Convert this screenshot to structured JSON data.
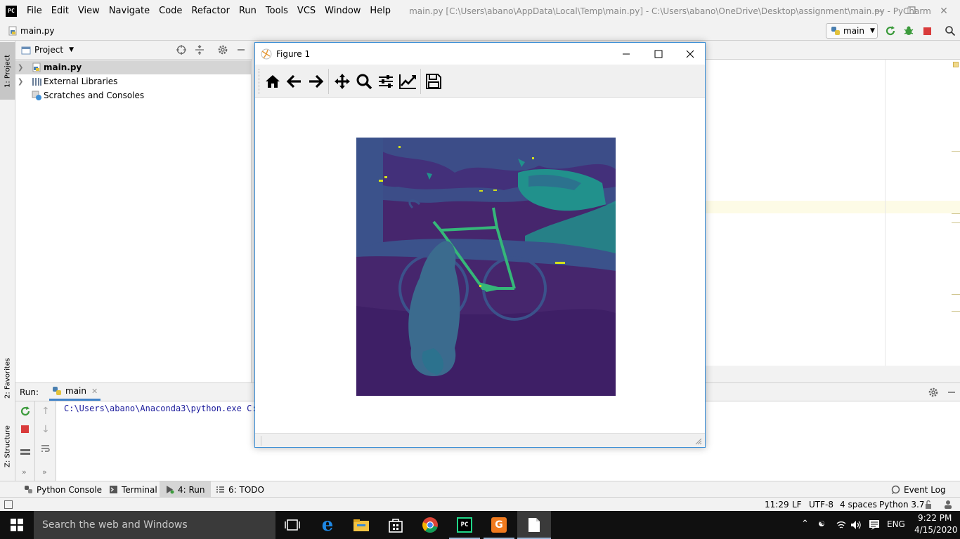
{
  "titlebar": {
    "logo": "PC",
    "menu": [
      "File",
      "Edit",
      "View",
      "Navigate",
      "Code",
      "Refactor",
      "Run",
      "Tools",
      "VCS",
      "Window",
      "Help"
    ],
    "window_title": "main.py [C:\\Users\\abano\\AppData\\Local\\Temp\\main.py] - C:\\Users\\abano\\OneDrive\\Desktop\\assignment\\main.py - PyCharm"
  },
  "navbar": {
    "breadcrumb": "main.py",
    "run_config": "main"
  },
  "left_strip": {
    "project_tab": "1: Project",
    "favorites_tab": "2: Favorites",
    "structure_tab": "Z: Structure"
  },
  "project": {
    "title": "Project",
    "items": [
      {
        "label": "main.py"
      },
      {
        "label": "External Libraries"
      },
      {
        "label": "Scratches and Consoles"
      }
    ]
  },
  "run_panel": {
    "label": "Run:",
    "tab": "main",
    "console": "C:\\Users\\abano\\Anaconda3\\python.exe C:/"
  },
  "bottom_tabs": [
    "Python Console",
    "Terminal",
    "4: Run",
    "6: TODO"
  ],
  "event_log": "Event Log",
  "status": {
    "position": "11:29",
    "line_sep": "LF",
    "encoding": "UTF-8",
    "indent": "4 spaces",
    "interpreter": "Python 3.7"
  },
  "figure": {
    "title": "Figure 1",
    "palette": {
      "bg": "#46266d",
      "mid": "#3b528b",
      "teal": "#21918c",
      "green": "#35b779",
      "yellow": "#d4e21a"
    }
  },
  "taskbar": {
    "search": "Search the web and Windows",
    "lang": "ENG",
    "time": "9:22 PM",
    "date": "4/15/2020"
  }
}
